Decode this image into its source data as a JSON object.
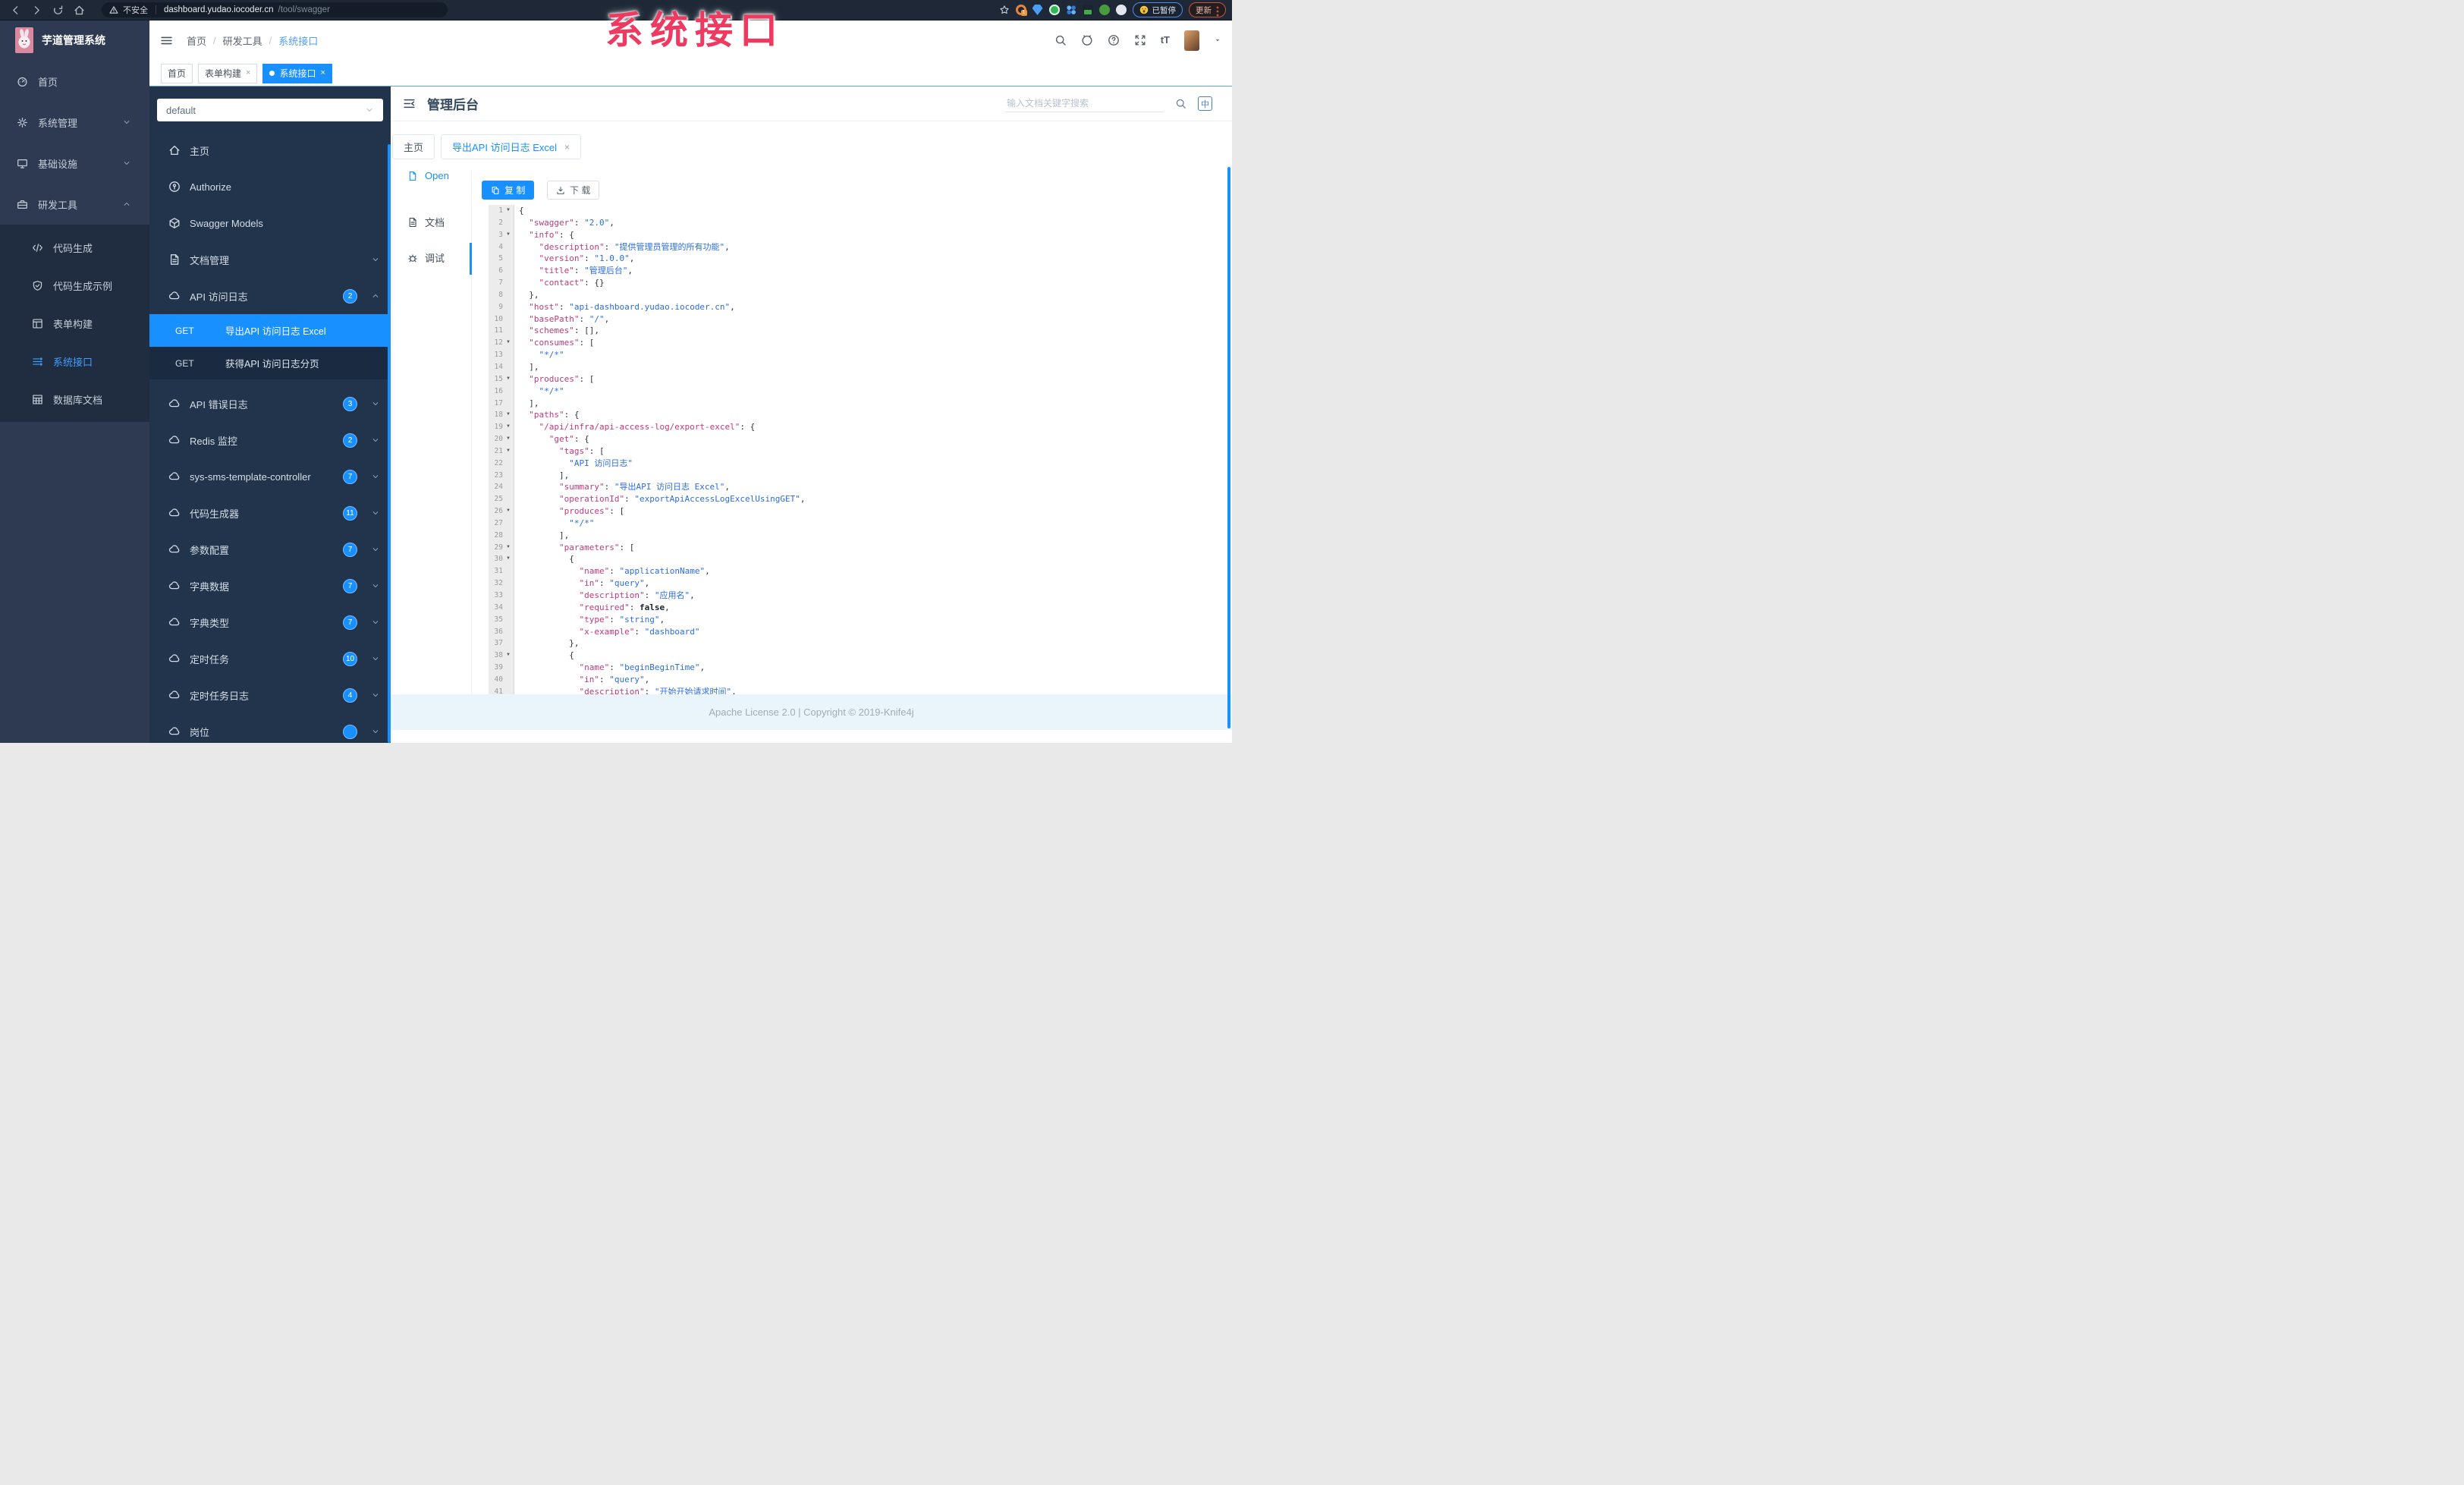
{
  "browser": {
    "security_label": "不安全",
    "url_host": "dashboard.yudao.iocoder.cn",
    "url_path": "/tool/swagger",
    "extension_badge": "1",
    "paused_label": "已暂停",
    "update_label": "更新"
  },
  "overlay_title": "系统接口",
  "sidebar": {
    "logo_title": "芋道管理系统",
    "items": [
      {
        "label": "首页",
        "icon": "dashboard"
      },
      {
        "label": "系统管理",
        "icon": "gear",
        "chevron": "down"
      },
      {
        "label": "基础设施",
        "icon": "monitor",
        "chevron": "down"
      },
      {
        "label": "研发工具",
        "icon": "toolbox",
        "chevron": "up"
      }
    ],
    "sub_items": [
      {
        "label": "代码生成",
        "icon": "code"
      },
      {
        "label": "代码生成示例",
        "icon": "shield"
      },
      {
        "label": "表单构建",
        "icon": "form"
      },
      {
        "label": "系统接口",
        "icon": "list",
        "active": true
      },
      {
        "label": "数据库文档",
        "icon": "db"
      }
    ]
  },
  "header": {
    "breadcrumb": [
      "首页",
      "研发工具",
      "系统接口"
    ]
  },
  "tags_view": [
    {
      "label": "首页"
    },
    {
      "label": "表单构建",
      "closable": true
    },
    {
      "label": "系统接口",
      "closable": true,
      "active": true
    }
  ],
  "swagger_panel": {
    "group_select_value": "default",
    "nav_items": [
      {
        "label": "主页",
        "icon": "home"
      },
      {
        "label": "Authorize",
        "icon": "lock"
      },
      {
        "label": "Swagger Models",
        "icon": "cube"
      },
      {
        "label": "文档管理",
        "icon": "doc",
        "chevron": "down"
      }
    ],
    "api_groups": [
      {
        "label": "API 访问日志",
        "count": "2",
        "expanded": true,
        "children": [
          {
            "method": "GET",
            "label": "导出API 访问日志 Excel",
            "active": true
          },
          {
            "method": "GET",
            "label": "获得API 访问日志分页"
          }
        ]
      },
      {
        "label": "API 错误日志",
        "count": "3"
      },
      {
        "label": "Redis 监控",
        "count": "2"
      },
      {
        "label": "sys-sms-template-controller",
        "count": "7"
      },
      {
        "label": "代码生成器",
        "count": "11"
      },
      {
        "label": "参数配置",
        "count": "7"
      },
      {
        "label": "字典数据",
        "count": "7"
      },
      {
        "label": "字典类型",
        "count": "7"
      },
      {
        "label": "定时任务",
        "count": "10"
      },
      {
        "label": "定时任务日志",
        "count": "4"
      },
      {
        "label": "岗位",
        "count": ""
      }
    ]
  },
  "content": {
    "title": "管理后台",
    "search_placeholder": "输入文档关键字搜索",
    "lang_label": "中",
    "doc_tabs": [
      {
        "label": "主页"
      },
      {
        "label": "导出API 访问日志 Excel",
        "active": true,
        "closable": true
      }
    ],
    "side_menu": [
      {
        "label": "文档",
        "icon": "doc"
      },
      {
        "label": "调试",
        "icon": "bug"
      },
      {
        "label": "Open",
        "icon": "file",
        "active": true
      }
    ],
    "copy_button": "复 制",
    "download_button": "下 载",
    "footer_text": "Apache License 2.0 | Copyright © 2019-Knife4j"
  },
  "code": {
    "lines": [
      {
        "n": 1,
        "fold": true,
        "t": "{"
      },
      {
        "n": 2,
        "t": "  \"swagger\": \"2.0\","
      },
      {
        "n": 3,
        "fold": true,
        "t": "  \"info\": {"
      },
      {
        "n": 4,
        "t": "    \"description\": \"提供管理员管理的所有功能\","
      },
      {
        "n": 5,
        "t": "    \"version\": \"1.0.0\","
      },
      {
        "n": 6,
        "t": "    \"title\": \"管理后台\","
      },
      {
        "n": 7,
        "t": "    \"contact\": {}"
      },
      {
        "n": 8,
        "t": "  },"
      },
      {
        "n": 9,
        "t": "  \"host\": \"api-dashboard.yudao.iocoder.cn\","
      },
      {
        "n": 10,
        "t": "  \"basePath\": \"/\","
      },
      {
        "n": 11,
        "t": "  \"schemes\": [],"
      },
      {
        "n": 12,
        "fold": true,
        "t": "  \"consumes\": ["
      },
      {
        "n": 13,
        "t": "    \"*/*\""
      },
      {
        "n": 14,
        "t": "  ],"
      },
      {
        "n": 15,
        "fold": true,
        "t": "  \"produces\": ["
      },
      {
        "n": 16,
        "t": "    \"*/*\""
      },
      {
        "n": 17,
        "t": "  ],"
      },
      {
        "n": 18,
        "fold": true,
        "t": "  \"paths\": {"
      },
      {
        "n": 19,
        "fold": true,
        "t": "    \"/api/infra/api-access-log/export-excel\": {"
      },
      {
        "n": 20,
        "fold": true,
        "t": "      \"get\": {"
      },
      {
        "n": 21,
        "fold": true,
        "t": "        \"tags\": ["
      },
      {
        "n": 22,
        "t": "          \"API 访问日志\""
      },
      {
        "n": 23,
        "t": "        ],"
      },
      {
        "n": 24,
        "t": "        \"summary\": \"导出API 访问日志 Excel\","
      },
      {
        "n": 25,
        "t": "        \"operationId\": \"exportApiAccessLogExcelUsingGET\","
      },
      {
        "n": 26,
        "fold": true,
        "t": "        \"produces\": ["
      },
      {
        "n": 27,
        "t": "          \"*/*\""
      },
      {
        "n": 28,
        "t": "        ],"
      },
      {
        "n": 29,
        "fold": true,
        "t": "        \"parameters\": ["
      },
      {
        "n": 30,
        "fold": true,
        "t": "          {"
      },
      {
        "n": 31,
        "t": "            \"name\": \"applicationName\","
      },
      {
        "n": 32,
        "t": "            \"in\": \"query\","
      },
      {
        "n": 33,
        "t": "            \"description\": \"应用名\","
      },
      {
        "n": 34,
        "t": "            \"required\": false,"
      },
      {
        "n": 35,
        "t": "            \"type\": \"string\","
      },
      {
        "n": 36,
        "t": "            \"x-example\": \"dashboard\""
      },
      {
        "n": 37,
        "t": "          },"
      },
      {
        "n": 38,
        "fold": true,
        "t": "          {"
      },
      {
        "n": 39,
        "t": "            \"name\": \"beginBeginTime\","
      },
      {
        "n": 40,
        "t": "            \"in\": \"query\","
      },
      {
        "n": 41,
        "t": "            \"description\": \"开始开始请求时间\","
      }
    ]
  },
  "colors": {
    "accent": "#1890ff",
    "code_key": "#c13a79",
    "code_string": "#2b6de0",
    "overlay": "#ee3a60"
  }
}
